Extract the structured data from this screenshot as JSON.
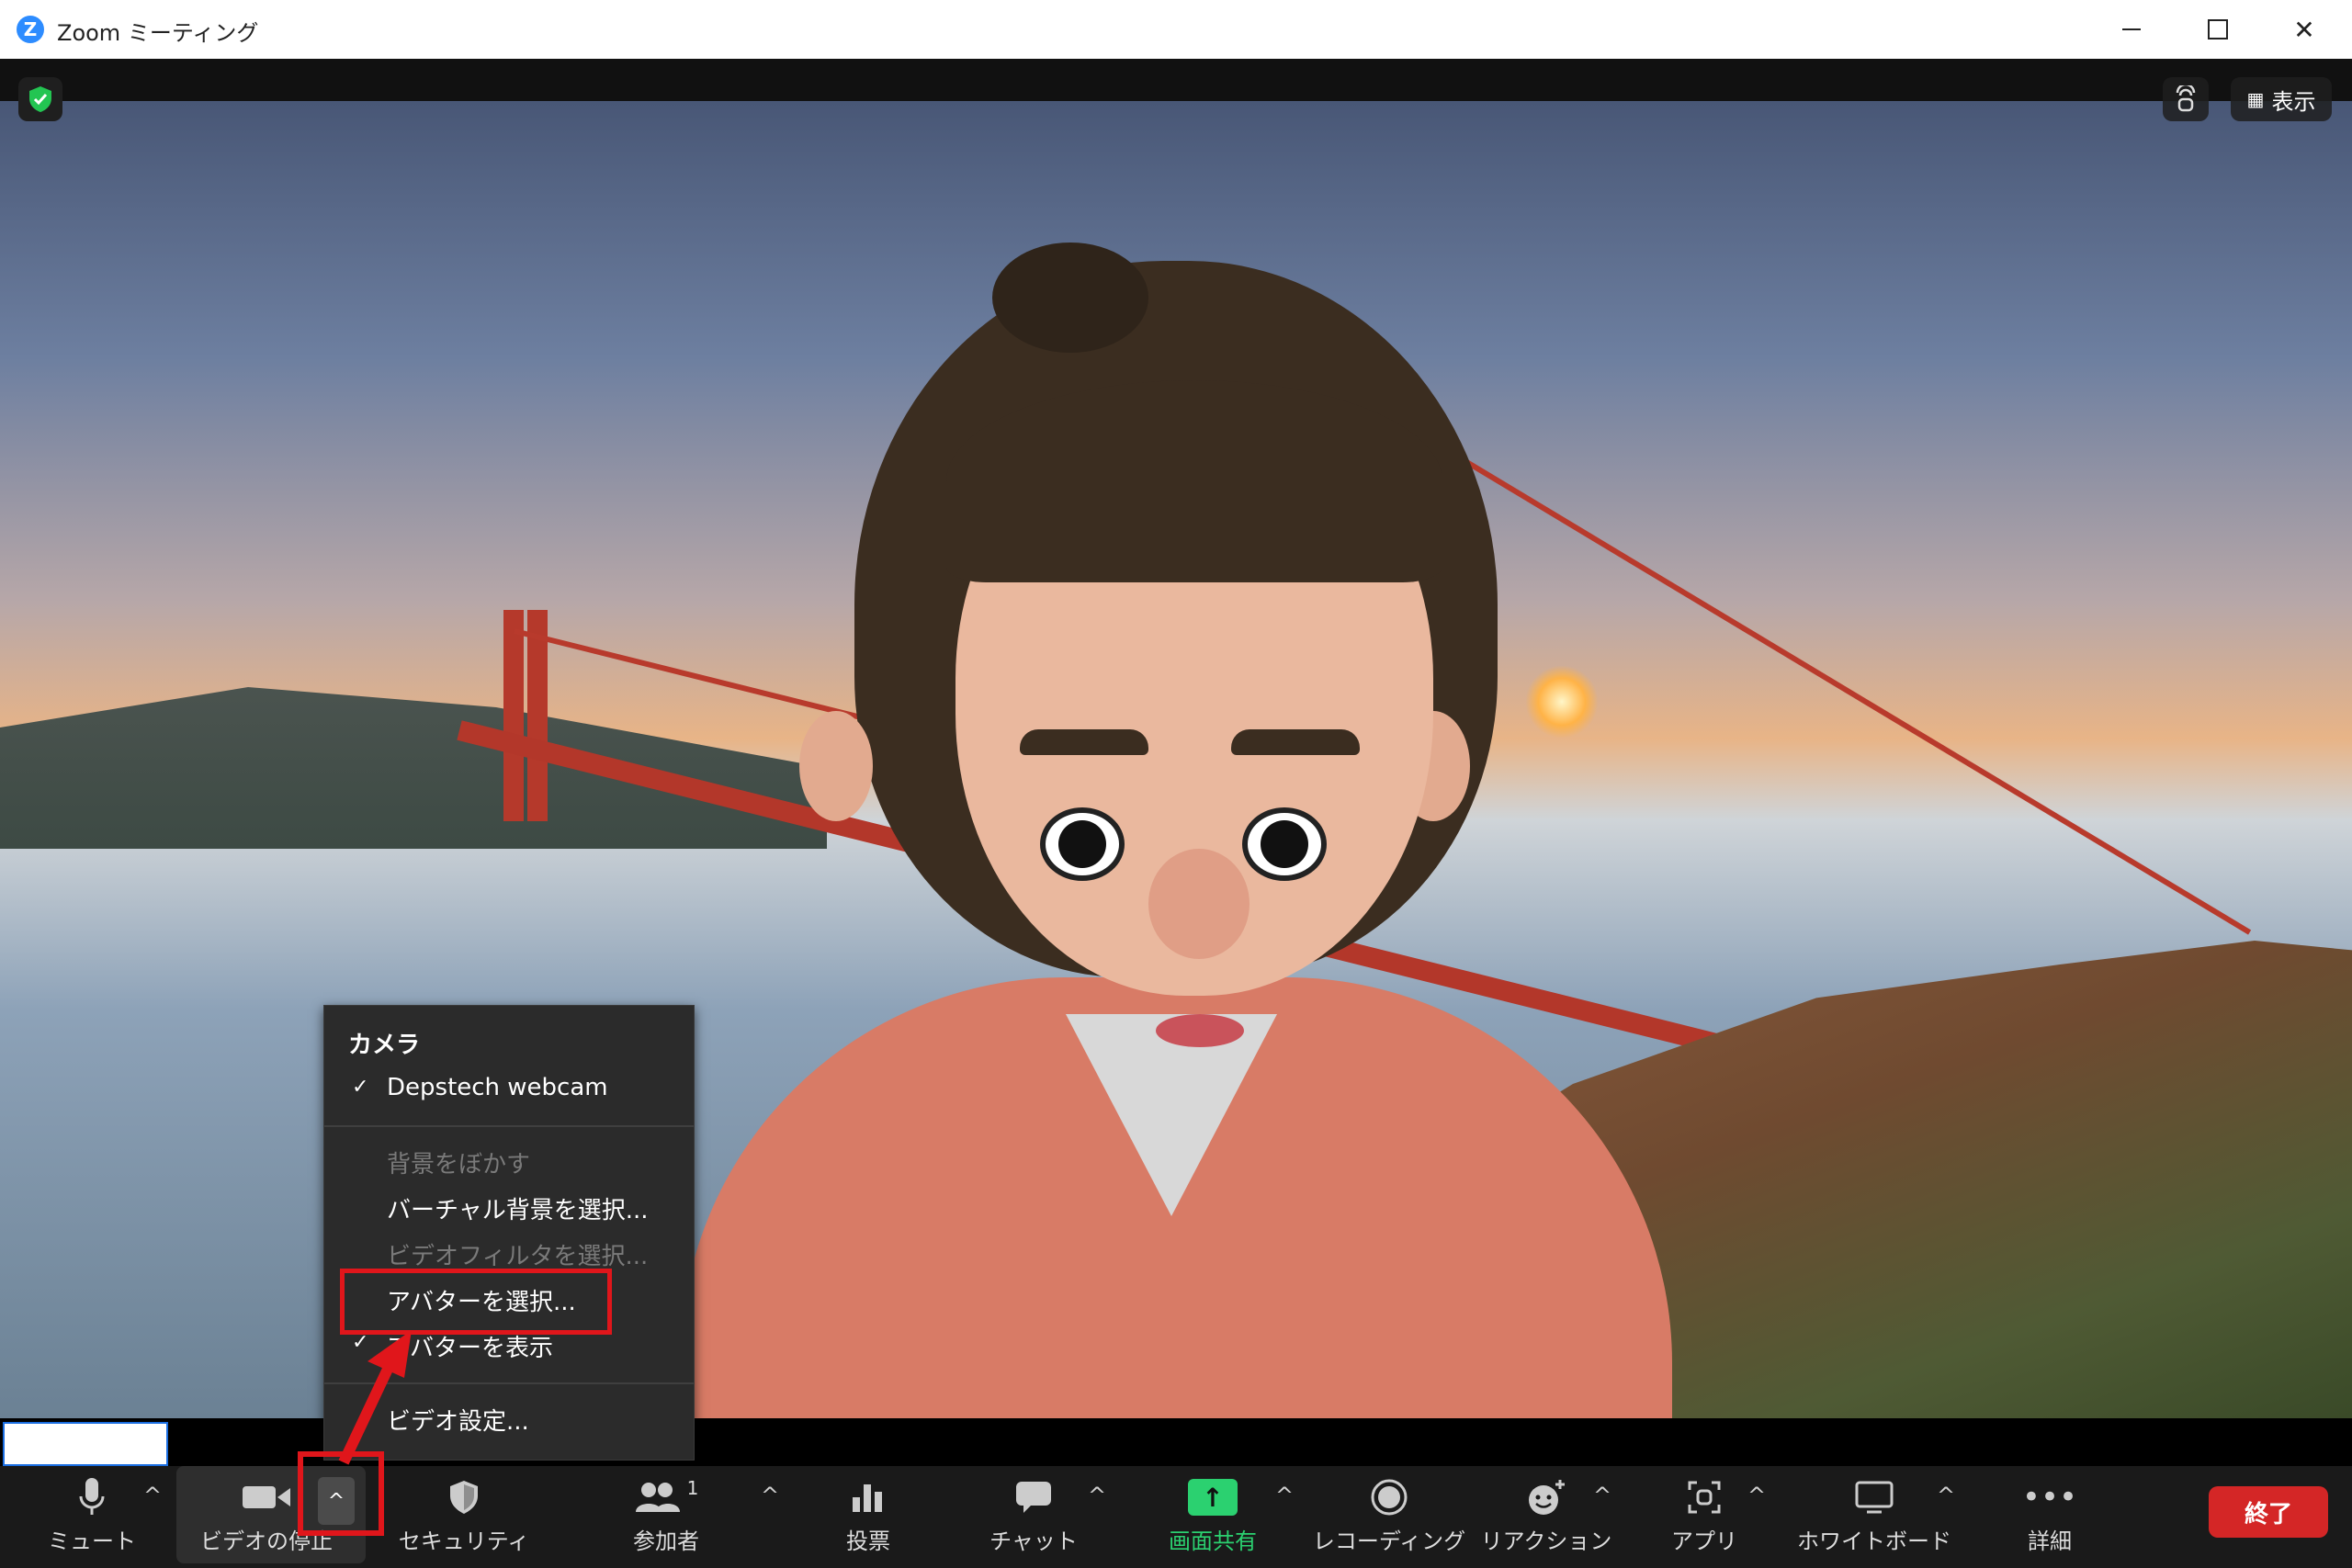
{
  "window": {
    "app_logo": "Z",
    "title": "Zoom ミーティング"
  },
  "video": {
    "view_label": "表示"
  },
  "camera_menu": {
    "heading": "カメラ",
    "camera_device": "Depstech webcam",
    "items": [
      {
        "label": "背景をぼかす",
        "disabled": true,
        "checked": false
      },
      {
        "label": "バーチャル背景を選択...",
        "disabled": false,
        "checked": false
      },
      {
        "label": "ビデオフィルタを選択...",
        "disabled": true,
        "checked": false
      },
      {
        "label": "アバターを選択...",
        "disabled": false,
        "checked": false
      },
      {
        "label": "アバターを表示",
        "disabled": false,
        "checked": true
      }
    ],
    "settings_label": "ビデオ設定...",
    "check_glyph": "✓"
  },
  "toolbar": {
    "mute": "ミュート",
    "stop_video": "ビデオの停止",
    "security": "セキュリティ",
    "participants": "参加者",
    "participants_count": "1",
    "polls": "投票",
    "chat": "チャット",
    "share_screen": "画面共有",
    "recording": "レコーディング",
    "reactions": "リアクション",
    "apps": "アプリ",
    "whiteboard": "ホワイトボード",
    "more": "詳細",
    "end": "終了",
    "caret": "^",
    "share_color": "#2bd170",
    "end_color": "#d42626"
  },
  "annotations": {
    "highlight_color": "#e0161b"
  }
}
